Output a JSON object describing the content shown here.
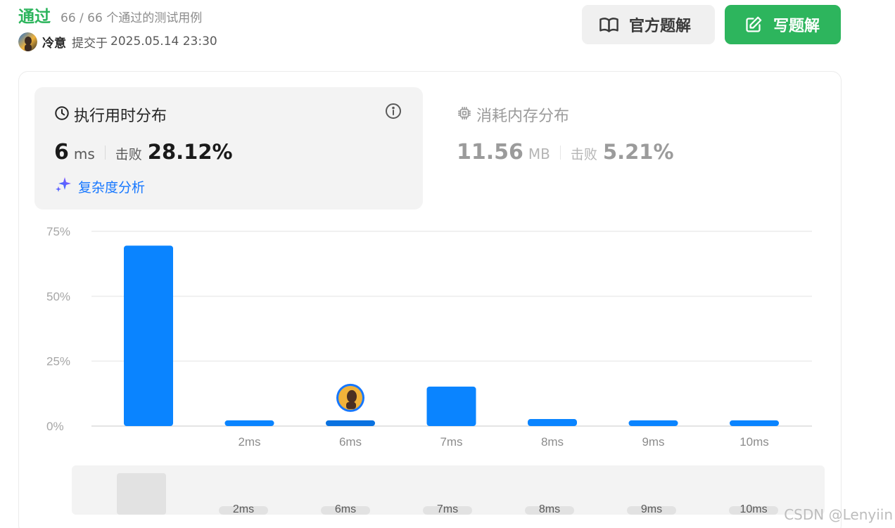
{
  "header": {
    "status": "通过",
    "test_count": "66 / 66 个通过的测试用例",
    "user_name": "冷意",
    "submit_prefix": "提交于",
    "submit_time": "2025.05.14 23:30"
  },
  "buttons": {
    "official_solution": "官方题解",
    "write_solution": "写题解"
  },
  "runtime": {
    "title": "执行用时分布",
    "value": "6",
    "unit": "ms",
    "beat_label": "击败",
    "beat_percent": "28.12%",
    "complexity_label": "复杂度分析"
  },
  "memory": {
    "title": "消耗内存分布",
    "value": "11.56",
    "unit": "MB",
    "beat_label": "击败",
    "beat_percent": "5.21%"
  },
  "colors": {
    "accent_green": "#2db55d",
    "bar_blue": "#0a84ff",
    "bar_highlight": "#0a72e0",
    "link_blue": "#1677ff"
  },
  "chart_data": {
    "type": "bar",
    "title": "",
    "xlabel": "",
    "ylabel": "",
    "ylim": [
      0,
      75
    ],
    "yticks": [
      "0%",
      "25%",
      "50%",
      "75%"
    ],
    "categories": [
      "",
      "2ms",
      "6ms",
      "7ms",
      "8ms",
      "9ms",
      "10ms"
    ],
    "values": [
      69.5,
      2.2,
      2.2,
      15.2,
      2.7,
      2.2,
      2.2
    ],
    "highlight_category": "6ms",
    "grid": true,
    "navigator_labels": [
      "2ms",
      "6ms",
      "7ms",
      "8ms",
      "9ms",
      "10ms"
    ]
  },
  "watermark": "CSDN @Lenyiin"
}
